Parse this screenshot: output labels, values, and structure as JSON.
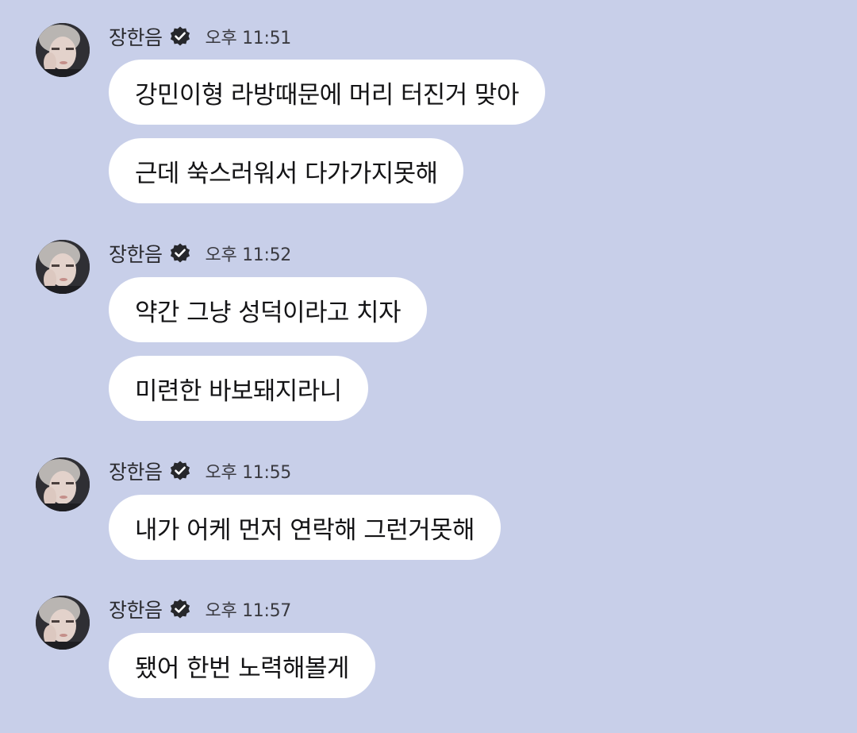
{
  "colors": {
    "background": "#c8cfe9",
    "bubble": "#ffffff",
    "text": "#141416"
  },
  "groups": [
    {
      "sender": "장한음",
      "verified_icon": "verified-check-icon",
      "time": "오후 11:51",
      "messages": [
        "강민이형 라방때문에 머리 터진거 맞아",
        "근데 쑥스러워서 다가가지못해"
      ]
    },
    {
      "sender": "장한음",
      "verified_icon": "verified-check-icon",
      "time": "오후 11:52",
      "messages": [
        "약간 그냥 성덕이라고 치자",
        "미련한 바보돼지라니"
      ]
    },
    {
      "sender": "장한음",
      "verified_icon": "verified-check-icon",
      "time": "오후 11:55",
      "messages": [
        "내가 어케 먼저 연락해 그런거못해"
      ]
    },
    {
      "sender": "장한음",
      "verified_icon": "verified-check-icon",
      "time": "오후 11:57",
      "messages": [
        "됐어 한번 노력해볼게"
      ]
    }
  ]
}
